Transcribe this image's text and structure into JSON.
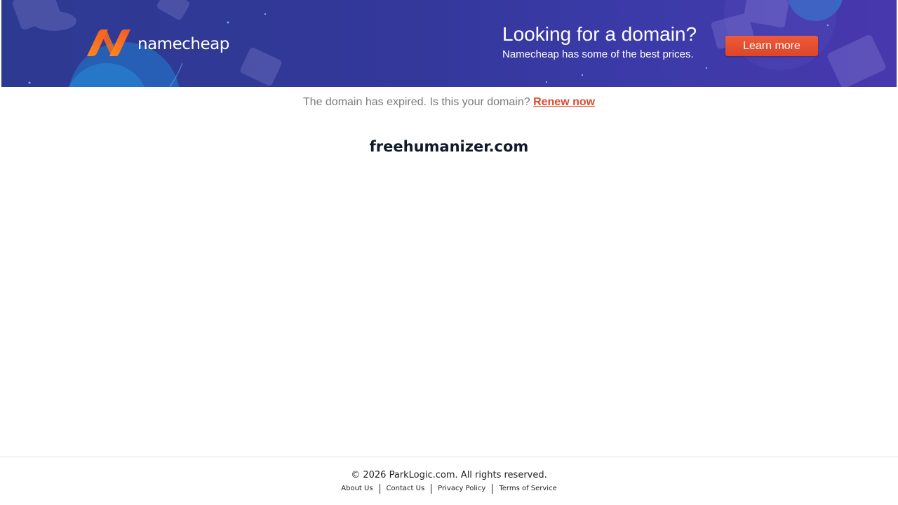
{
  "banner": {
    "logo_text": "namecheap",
    "promo_title": "Looking for a domain?",
    "promo_subtitle": "Namecheap has some of the best prices.",
    "learn_more_label": "Learn more",
    "colors": {
      "background_start": "#2d3a91",
      "background_end": "#4838ad",
      "button": "#de4a2c",
      "logo_orange": "#f26b21"
    }
  },
  "notice": {
    "text": "The domain has expired. Is this your domain?",
    "renew_label": "Renew now"
  },
  "domain": {
    "name": "freehumanizer.com"
  },
  "footer": {
    "copyright": "© 2026 ParkLogic.com. All rights reserved.",
    "links": [
      {
        "label": "About Us"
      },
      {
        "label": "Contact Us"
      },
      {
        "label": "Privacy Policy"
      },
      {
        "label": "Terms of Service"
      }
    ]
  }
}
